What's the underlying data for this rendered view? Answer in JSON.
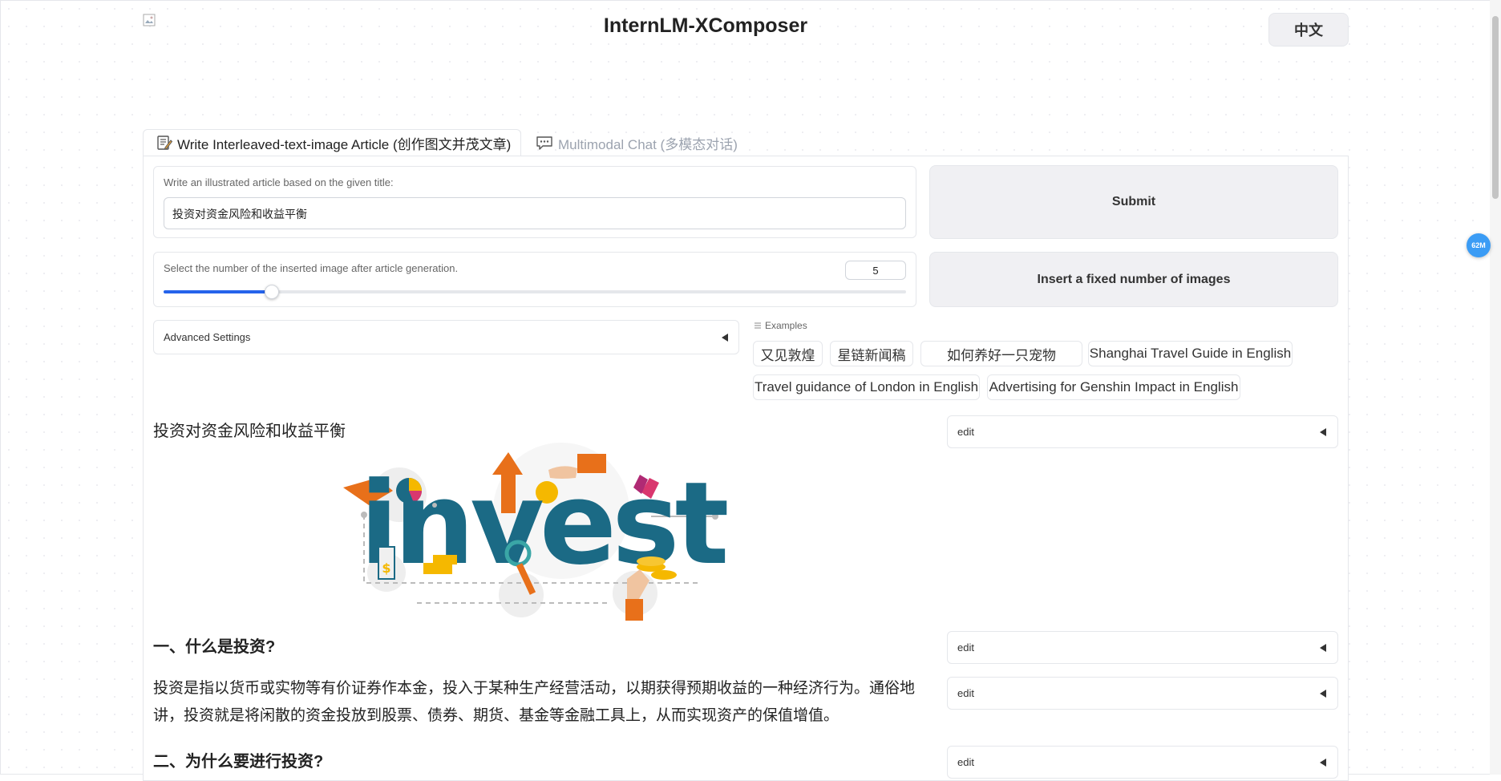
{
  "header": {
    "title": "InternLM-XComposer",
    "lang_button": "中文"
  },
  "tabs": [
    {
      "label": "Write Interleaved-text-image Article (创作图文并茂文章)",
      "active": true,
      "icon": "memo-icon"
    },
    {
      "label": "Multimodal Chat (多模态对话)",
      "active": false,
      "icon": "speech-bubble-icon"
    }
  ],
  "form": {
    "title_label": "Write an illustrated article based on the given title:",
    "title_value": "投资对资金风险和收益平衡",
    "submit_label": "Submit",
    "slider_label": "Select the number of the inserted image after article generation.",
    "slider_value": "5",
    "slider_fraction": 0.146,
    "insert_label": "Insert a fixed number of images",
    "advanced_label": "Advanced Settings"
  },
  "examples": {
    "label": "Examples",
    "items": [
      "又见敦煌",
      "星链新闻稿",
      "如何养好一只宠物",
      "Shanghai Travel Guide in English",
      "Travel guidance of London in English",
      "Advertising for Genshin Impact in English"
    ]
  },
  "article": {
    "title": "投资对资金风险和收益平衡",
    "image_word": "invest",
    "section1_heading": "一、什么是投资?",
    "section1_para": "投资是指以货币或实物等有价证券作本金，投入于某种生产经营活动，以期获得预期收益的一种经济行为。通俗地讲，投资就是将闲散的资金投放到股票、债券、期货、基金等金融工具上，从而实现资产的保值增值。",
    "section2_heading": "二、为什么要进行投资?"
  },
  "edit_label": "edit",
  "badge": "62M",
  "colors": {
    "accent": "#2563eb",
    "button_bg": "#f0f0f3",
    "border": "#e5e7eb",
    "invest_teal": "#1b6a85",
    "invest_orange": "#e8701a"
  }
}
